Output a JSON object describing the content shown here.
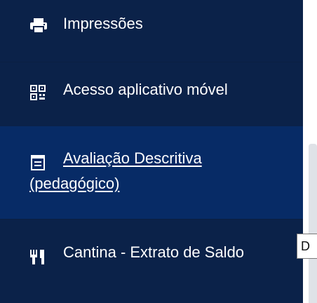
{
  "colors": {
    "sidebar_bg": "#0b2249",
    "active_item_bg": "#072b66",
    "text": "#ffffff",
    "scrollbar_thumb": "#dfe2e7"
  },
  "menu": {
    "items": [
      {
        "icon": "printer-icon",
        "label": "Impressões"
      },
      {
        "icon": "qr-code-icon",
        "label": "Acesso aplicativo móvel"
      },
      {
        "icon": "notebook-icon",
        "label": "Avaliação Descritiva (pedagógico)",
        "active": true
      },
      {
        "icon": "cutlery-icon",
        "label": "Cantina - Extrato de Saldo"
      }
    ]
  },
  "tooltip": {
    "text": "D"
  }
}
